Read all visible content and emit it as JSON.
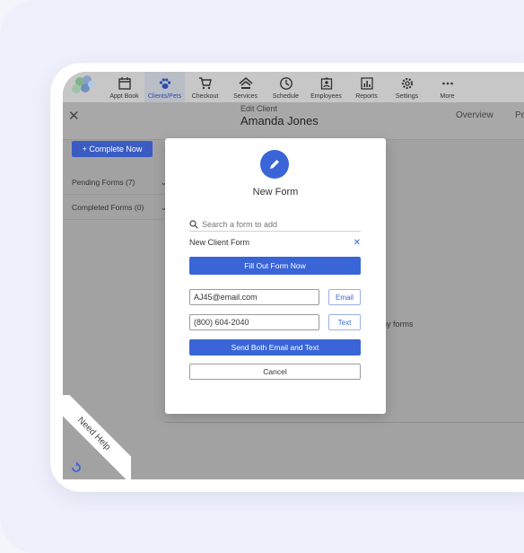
{
  "nav": {
    "items": [
      {
        "label": "Appt Book",
        "icon": "calendar-icon"
      },
      {
        "label": "Clients/Pets",
        "icon": "paw-icon",
        "active": true
      },
      {
        "label": "Checkout",
        "icon": "cart-icon"
      },
      {
        "label": "Services",
        "icon": "services-icon"
      },
      {
        "label": "Schedule",
        "icon": "clock-icon"
      },
      {
        "label": "Employees",
        "icon": "employees-icon"
      },
      {
        "label": "Reports",
        "icon": "reports-icon"
      },
      {
        "label": "Settings",
        "icon": "gear-icon"
      },
      {
        "label": "More",
        "icon": "more-icon"
      }
    ]
  },
  "header": {
    "close": "✕",
    "edit_label": "Edit Client",
    "client_name": "Amanda Jones",
    "tab_overview": "Overview",
    "tab_partial": "Pe"
  },
  "sidebar": {
    "complete_now": "+ Complete Now",
    "pending": "Pending Forms (7)",
    "completed": "Completed Forms (0)"
  },
  "background_text": "ny forms",
  "modal": {
    "title": "New Form",
    "search_placeholder": "Search a form to add",
    "selected_form": "New Client Form",
    "remove": "✕",
    "fill_out": "Fill Out Form Now",
    "email_value": "AJ45@email.com",
    "email_button": "Email",
    "phone_value": "(800) 604-2040",
    "text_button": "Text",
    "send_both": "Send Both Email and Text",
    "cancel": "Cancel"
  },
  "help": {
    "label": "Need Help"
  },
  "colors": {
    "accent": "#3a65d8",
    "sidebar_button": "#3a5bc2",
    "overlay": "#a2a2a2"
  }
}
